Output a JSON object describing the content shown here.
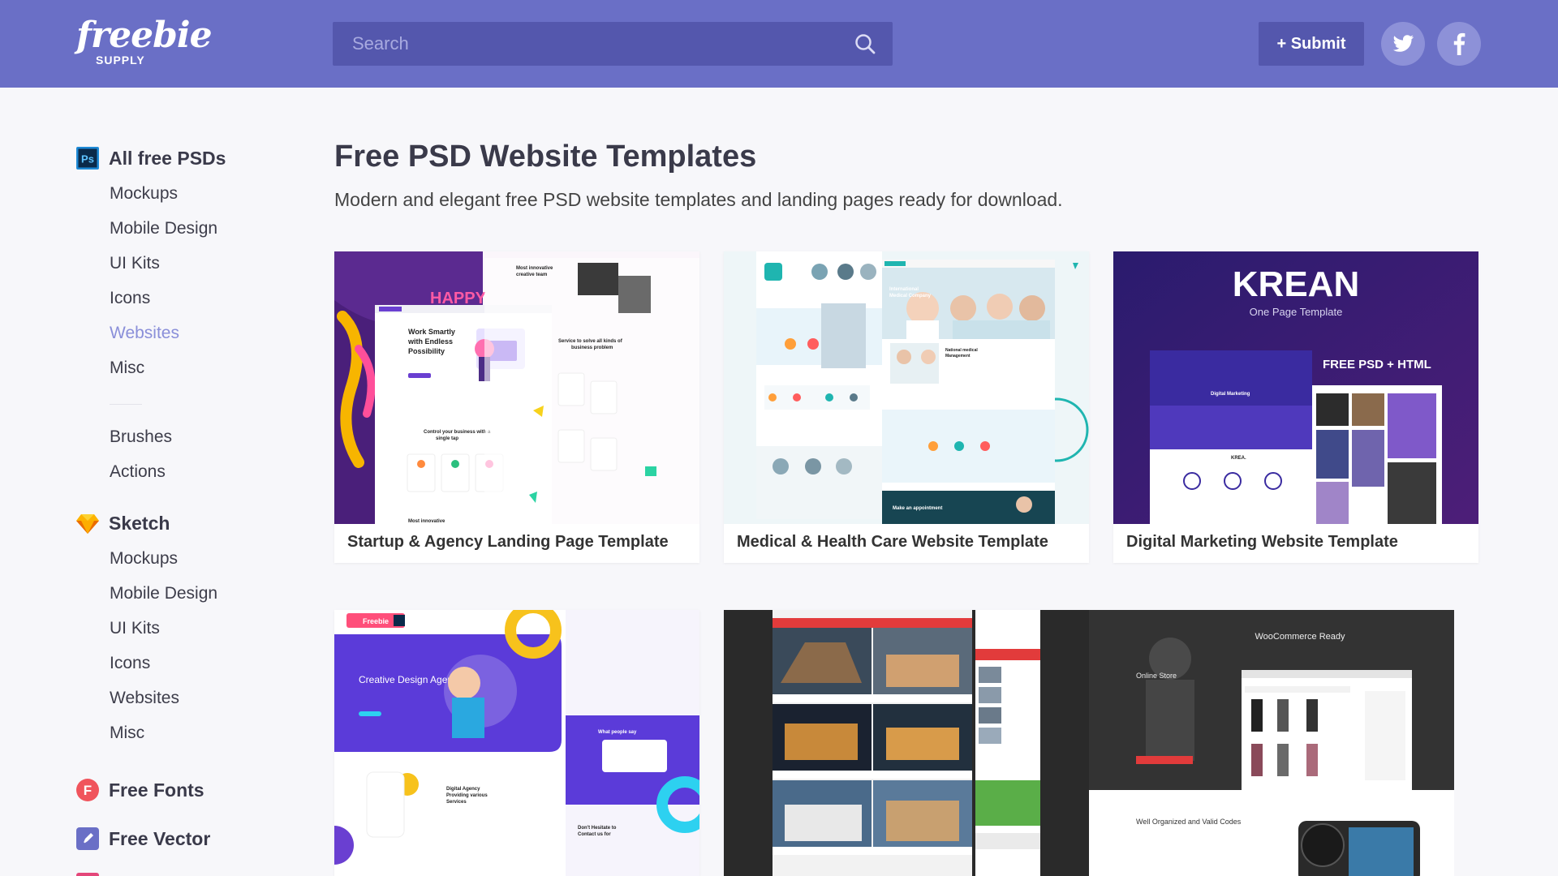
{
  "header": {
    "logo_main": "freebie",
    "logo_sub": "SUPPLY",
    "search_placeholder": "Search",
    "submit_label": "+ Submit",
    "social": [
      "twitter-icon",
      "facebook-icon"
    ],
    "colors": {
      "header_bg": "#6a6fc6",
      "search_bg": "#5457ad",
      "social_bg": "#8d91d8"
    }
  },
  "sidebar": {
    "psd": {
      "label": "All free PSDs",
      "icon": "photoshop-icon",
      "items": [
        "Mockups",
        "Mobile Design",
        "UI Kits",
        "Icons",
        "Websites",
        "Misc"
      ],
      "extra_items": [
        "Brushes",
        "Actions"
      ],
      "active": "Websites"
    },
    "sketch": {
      "label": "Sketch",
      "icon": "sketch-diamond-icon",
      "items": [
        "Mockups",
        "Mobile Design",
        "UI Kits",
        "Icons",
        "Websites",
        "Misc"
      ]
    },
    "fonts": {
      "label": "Free Fonts",
      "icon": "fonts-icon"
    },
    "vector": {
      "label": "Free Vector",
      "icon": "vector-pen-icon"
    },
    "active_color": "#8a8fd9"
  },
  "main": {
    "title": "Free PSD Website Templates",
    "description": "Modern and elegant free PSD website templates and landing pages ready for download.",
    "cards": [
      {
        "title": "Startup & Agency Landing Page Template"
      },
      {
        "title": "Medical & Health Care Website Template"
      },
      {
        "title": "Digital Marketing Website Template",
        "thumb_heading": "KREAN",
        "thumb_sub": "One Page Template",
        "thumb_badge": "FREE PSD + HTML"
      },
      {
        "title": "",
        "thumb_heading": "Creative Design Agency",
        "thumb_brand": "Freebie"
      },
      {
        "title": ""
      },
      {
        "title": "",
        "thumb_heading": "WooCommerce Ready",
        "thumb_sub": "Online Store",
        "thumb_note": "Well Organized and Valid Codes"
      }
    ]
  }
}
